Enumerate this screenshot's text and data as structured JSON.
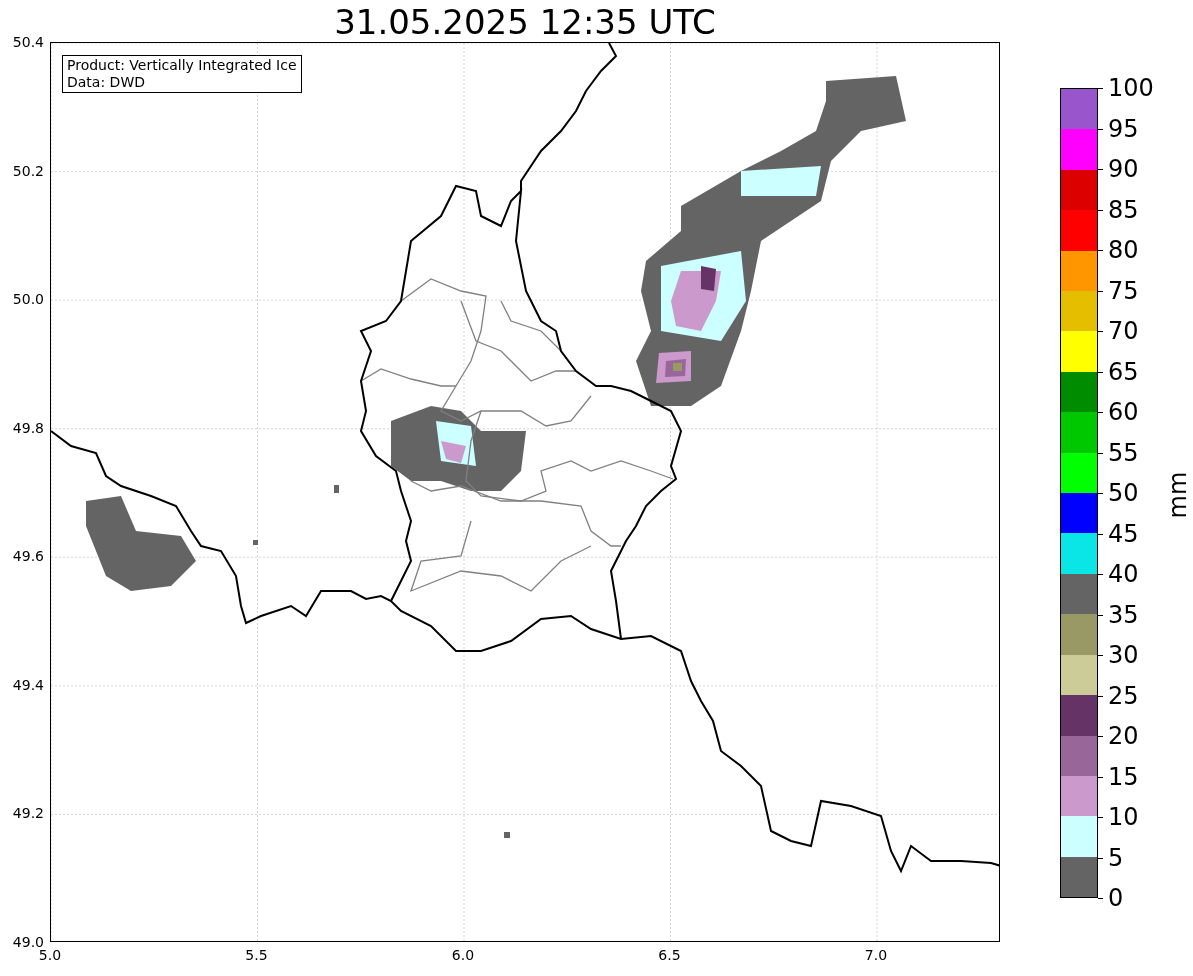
{
  "title": "31.05.2025 12:35 UTC",
  "legend": [
    "Product: Vertically Integrated Ice",
    "Data: DWD"
  ],
  "map": {
    "xticks": [
      "5.0",
      "5.5",
      "6.0",
      "6.5",
      "7.0"
    ],
    "yticks": [
      "50.4",
      "50.2",
      "50.0",
      "49.8",
      "49.6",
      "49.4",
      "49.2",
      "49.0"
    ]
  },
  "colorbar": {
    "label": "mm",
    "bins": [
      {
        "color": "#9955cc"
      },
      {
        "color": "#ff00ff"
      },
      {
        "color": "#dc0000"
      },
      {
        "color": "#ff0000"
      },
      {
        "color": "#ff9600"
      },
      {
        "color": "#e6be00"
      },
      {
        "color": "#ffff00"
      },
      {
        "color": "#008c00"
      },
      {
        "color": "#00c800"
      },
      {
        "color": "#00ff00"
      },
      {
        "color": "#0000ff"
      },
      {
        "color": "#0ae6e6"
      },
      {
        "color": "#646464"
      },
      {
        "color": "#999966"
      },
      {
        "color": "#cccc99"
      },
      {
        "color": "#663366"
      },
      {
        "color": "#996699"
      },
      {
        "color": "#cc99cc"
      },
      {
        "color": "#ccffff"
      },
      {
        "color": "#646464"
      }
    ],
    "tick_labels": [
      "100",
      "95",
      "90",
      "85",
      "80",
      "75",
      "70",
      "65",
      "60",
      "55",
      "50",
      "45",
      "40",
      "35",
      "30",
      "25",
      "20",
      "15",
      "10",
      "5",
      "0"
    ]
  }
}
